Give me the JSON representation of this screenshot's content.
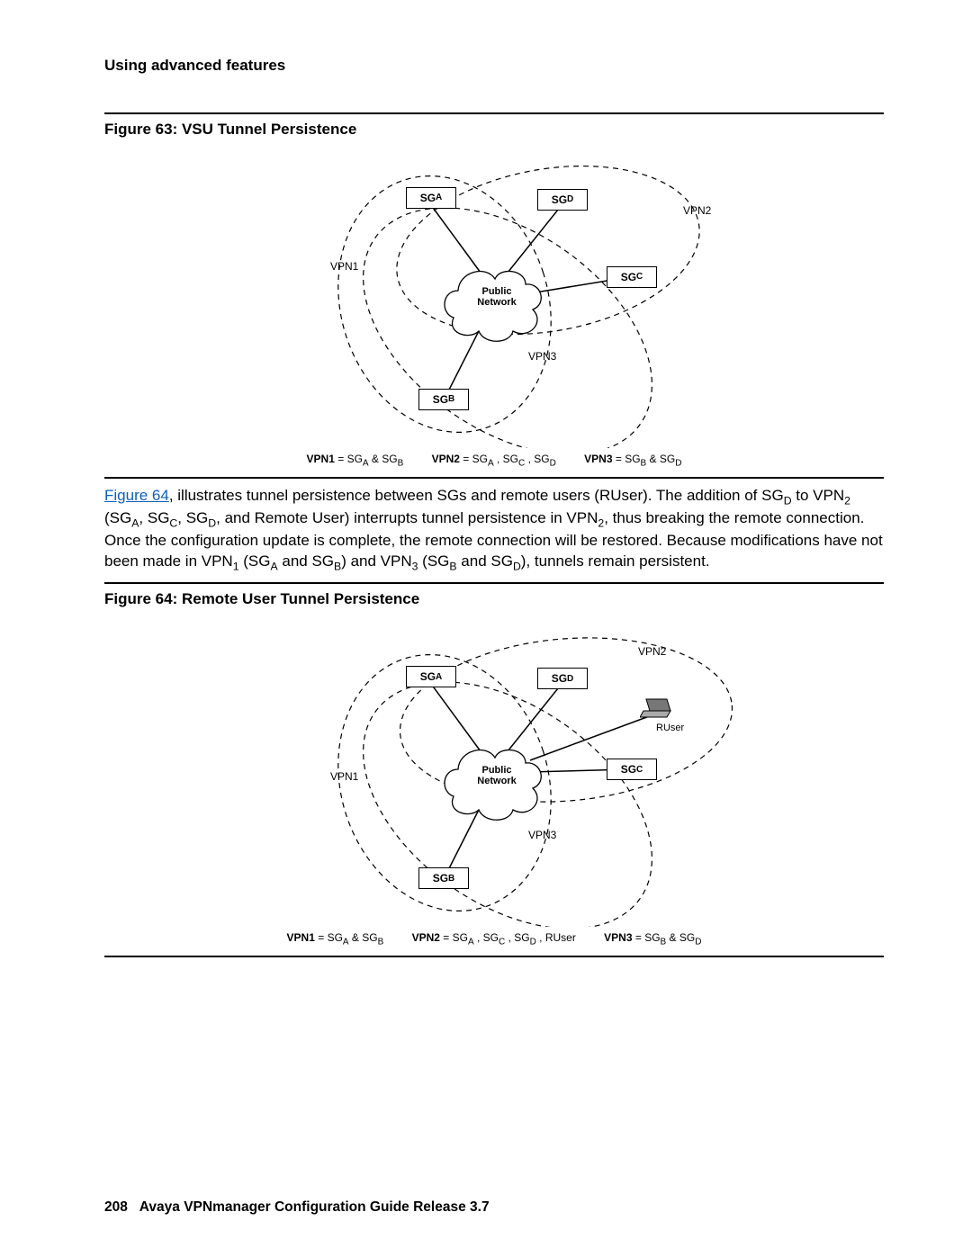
{
  "header": {
    "section": "Using advanced features"
  },
  "figure63": {
    "title": "Figure 63: VSU Tunnel Persistence",
    "labels": {
      "sga": "SGA",
      "sgb": "SGB",
      "sgc": "SGC",
      "sgd": "SGD",
      "vpn1": "VPN1",
      "vpn2": "VPN2",
      "vpn3": "VPN3",
      "public": "Public",
      "network": "Network"
    },
    "legend": {
      "v1_lhs": "VPN1",
      "v1_rhs": " = SGA & SGB",
      "v2_lhs": "VPN2",
      "v2_rhs": " = SGA , SGC , SGD",
      "v3_lhs": "VPN3",
      "v3_rhs": " = SGB & SGD"
    }
  },
  "paragraph": {
    "link": "Figure 64",
    "p1": ", illustrates tunnel persistence between SGs and remote users (RUser). The addition of SG",
    "p2": " to VPN",
    "p3": " (SG",
    "p4": ", SG",
    "p5": ", SG",
    "p6": ", and Remote User) interrupts tunnel persistence in VPN",
    "p7": ", thus breaking the remote connection. Once the configuration update is complete, the remote connection will be restored. Because modifications have not been made in VPN",
    "p8": " (SG",
    "p9": " and SG",
    "p10": ") and VPN",
    "p11": " (SG",
    "p12": " and SG",
    "p13": "), tunnels remain persistent.",
    "subs": {
      "D": "D",
      "two_a": "2",
      "A": "A",
      "C": "C",
      "D2": "D",
      "two_b": "2",
      "one": "1",
      "A2": "A",
      "B": "B",
      "three": "3",
      "B2": "B",
      "D3": "D"
    }
  },
  "figure64": {
    "title": "Figure 64: Remote User Tunnel Persistence",
    "labels": {
      "sga": "SGA",
      "sgb": "SGB",
      "sgc": "SGC",
      "sgd": "SGD",
      "vpn1": "VPN1",
      "vpn2": "VPN2",
      "vpn3": "VPN3",
      "ruser": "RUser",
      "public": "Public",
      "network": "Network"
    },
    "legend": {
      "v1_lhs": "VPN1",
      "v1_rhs": " = SGA & SGB",
      "v2_lhs": "VPN2",
      "v2_rhs": " = SGA , SGC , SGD , RUser",
      "v3_lhs": "VPN3",
      "v3_rhs": " = SGB & SGD"
    }
  },
  "footer": {
    "page": "208",
    "title": "Avaya VPNmanager Configuration Guide Release 3.7"
  }
}
